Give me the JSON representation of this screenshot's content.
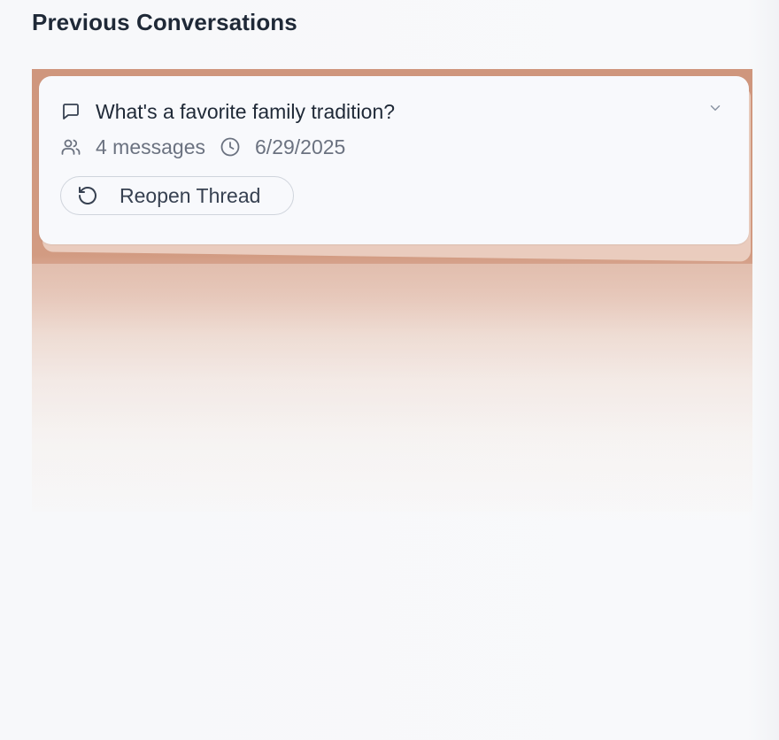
{
  "page": {
    "heading": "Previous Conversations"
  },
  "threads": [
    {
      "title": "What's a favorite family tradition?",
      "messages": "4 messages",
      "date": "6/29/2025",
      "reopen_label": "Reopen Thread",
      "icons": {
        "title": "message-square-icon",
        "participants": "users-icon",
        "date": "clock-icon",
        "reopen": "rotate-ccw-icon",
        "expand": "chevron-down-icon"
      }
    }
  ],
  "colors": {
    "background": "#f7f8fa",
    "card": "#f8f9fc",
    "highlight_glow": "#cf967d",
    "text_primary": "#1f2937",
    "text_muted": "#6b7280",
    "button_border": "#cfd4dc"
  }
}
